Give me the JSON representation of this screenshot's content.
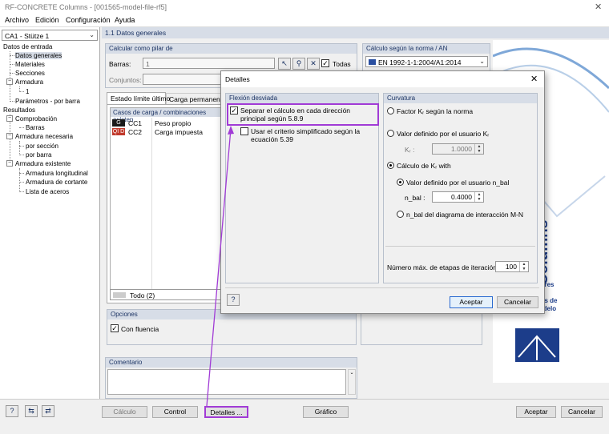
{
  "window": {
    "title": "RF-CONCRETE Columns - [001565-model-file-rf5]",
    "close_icon": "close-icon"
  },
  "menu": [
    "Archivo",
    "Edición",
    "Configuración",
    "Ayuda"
  ],
  "case_selector": {
    "value": "CA1 - Stütze 1"
  },
  "tree": {
    "input_root": "Datos de entrada",
    "input_items": [
      "Datos generales",
      "Materiales",
      "Secciones",
      "Armadura",
      "1",
      "Parámetros - por barra"
    ],
    "results_root": "Resultados",
    "results_items": [
      "Comprobación",
      "Barras",
      "Armadura necesaria",
      "por sección",
      "por barra",
      "Armadura existente",
      "Armadura longitudinal",
      "Armadura de cortante",
      "Lista de aceros"
    ]
  },
  "main": {
    "header": "1.1 Datos generales",
    "calc_group": "Calcular como pilar de",
    "barras_label": "Barras:",
    "barras_value": "1",
    "todas_label": "Todas",
    "conjuntos_label": "Conjuntos:",
    "norm_group": "Cálculo según la norma / AN",
    "norm_value": "EN 1992-1-1:2004/A1:2014",
    "tab_uls": "Estado límite último",
    "tab_perm": "Carga permanente",
    "cases_header": "Casos de carga / combinaciones existen",
    "cases": [
      {
        "tag": "G",
        "id": "CC1",
        "name": "Peso propio",
        "color": "#1a1a1a"
      },
      {
        "tag": "QI D",
        "id": "CC2",
        "name": "Carga impuesta",
        "color": "#c0392b"
      }
    ],
    "all_label": "Todo (2)",
    "options_group": "Opciones",
    "creep_label": "Con fluencia",
    "comment_group": "Comentario",
    "banner_title": "Columns",
    "banner_lines": [
      "e pilares",
      "ión",
      "nálisis de",
      "a modelo"
    ]
  },
  "dialog": {
    "title": "Detalles",
    "left_group": "Flexión desviada",
    "opt1": "Separar el cálculo en cada dirección principal según 5.8.9",
    "opt2": "Usar el criterio simplificado según la ecuación 5.39",
    "right_group": "Curvatura",
    "r1": "Factor Kᵣ según la norma",
    "r2": "Valor definido por el usuario Kᵣ",
    "kr_label": "Kᵣ :",
    "kr_value": "1.0000",
    "r3": "Cálculo de Kᵣ with",
    "r3a": "Valor definido por el usuario n_bal",
    "nbal_label": "n_bal :",
    "nbal_value": "0.4000",
    "r3b": "n_bal del diagrama de interacción M-N",
    "iter_label": "Número máx. de etapas de iteración:",
    "iter_value": "100",
    "accept": "Aceptar",
    "cancel": "Cancelar"
  },
  "bottom": {
    "calc": "Cálculo",
    "control": "Control",
    "details": "Detalles ...",
    "graphic": "Gráfico",
    "accept": "Aceptar",
    "cancel": "Cancelar"
  },
  "colors": {
    "highlight": "#a13bd6",
    "header_bg": "#d7dde7",
    "header_fg": "#1c3464"
  }
}
